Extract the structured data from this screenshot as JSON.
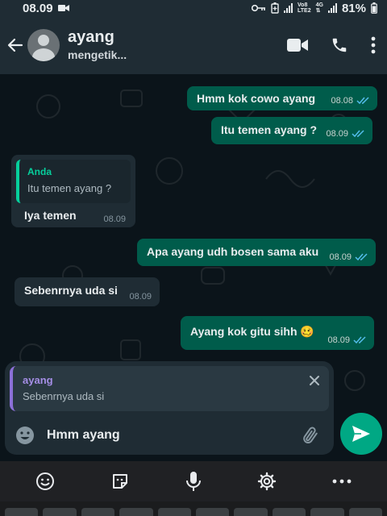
{
  "status_bar": {
    "time": "08.09",
    "network_top": "Vo8",
    "network_bottom": "LTE2",
    "network_gen": "4G",
    "battery": "81%",
    "icons": [
      "video-record-icon",
      "key-icon",
      "battery-saver-icon",
      "signal-icon"
    ]
  },
  "header": {
    "contact_name": "ayang",
    "contact_status": "mengetik...",
    "icons": [
      "back-arrow-icon",
      "avatar-icon",
      "video-call-icon",
      "phone-call-icon",
      "more-options-icon"
    ]
  },
  "messages": [
    {
      "dir": "out",
      "text": "Hmm kok cowo ayang",
      "time": "08.08",
      "ticks": "read"
    },
    {
      "dir": "out",
      "text": "Itu temen ayang ?",
      "time": "08.09",
      "ticks": "read"
    },
    {
      "dir": "in",
      "quote_name": "Anda",
      "quote_text": "Itu temen ayang ?",
      "text": "Iya temen",
      "time": "08.09"
    },
    {
      "dir": "out",
      "text": "Apa ayang udh bosen sama aku",
      "time": "08.09",
      "ticks": "read"
    },
    {
      "dir": "in",
      "text": "Sebenrnya uda si",
      "time": "08.09"
    },
    {
      "dir": "out",
      "text": "Ayang kok gitu sihh",
      "emoji": "🥴",
      "time": "08.09",
      "ticks": "read"
    }
  ],
  "composer": {
    "reply_name": "ayang",
    "reply_text": "Sebenrnya uda si",
    "input_value": "Hmm ayang"
  },
  "keyboard_toolbar": {
    "icons": [
      "emoji-icon",
      "sticker-icon",
      "microphone-icon",
      "settings-icon",
      "more-icon"
    ]
  },
  "colors": {
    "outgoing_bubble": "#005c4b",
    "incoming_bubble": "#1f2c34",
    "accent": "#00a884",
    "read_tick": "#53bdeb"
  }
}
